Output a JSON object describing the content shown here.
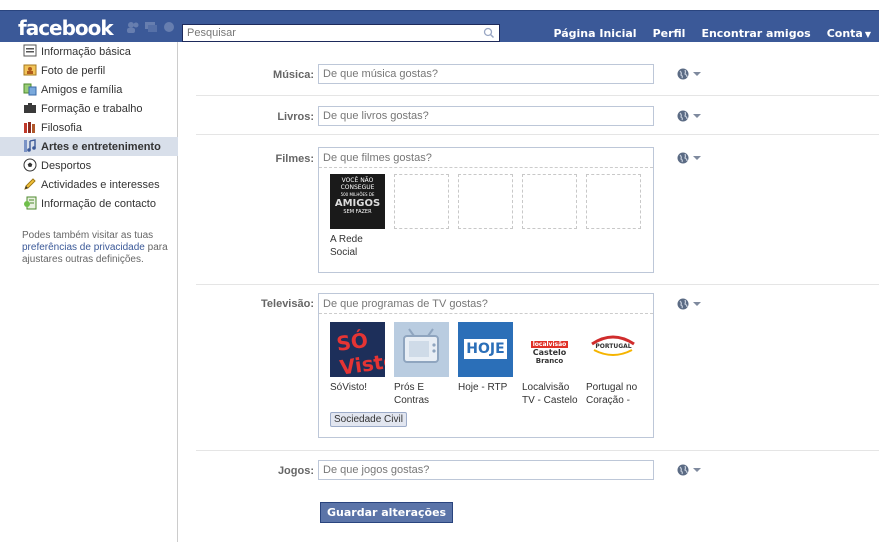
{
  "topbar": {
    "logo": "facebook",
    "search_placeholder": "Pesquisar",
    "nav": [
      {
        "label": "Página Inicial"
      },
      {
        "label": "Perfil"
      },
      {
        "label": "Encontrar amigos"
      },
      {
        "label": "Conta"
      }
    ]
  },
  "sidebar": {
    "items": [
      {
        "label": "Informação básica",
        "icon": "info-icon"
      },
      {
        "label": "Foto de perfil",
        "icon": "photo-icon"
      },
      {
        "label": "Amigos e família",
        "icon": "friends-icon"
      },
      {
        "label": "Formação e trabalho",
        "icon": "briefcase-icon"
      },
      {
        "label": "Filosofia",
        "icon": "books-icon"
      },
      {
        "label": "Artes e entretenimento",
        "icon": "music-icon",
        "active": true
      },
      {
        "label": "Desportos",
        "icon": "soccer-ball-icon"
      },
      {
        "label": "Actividades e interesses",
        "icon": "pencil-icon"
      },
      {
        "label": "Informação de contacto",
        "icon": "contact-icon"
      }
    ],
    "note_prefix": "Podes também visitar as tuas",
    "note_link": "preferências de privacidade",
    "note_suffix": "para ajustares outras definições."
  },
  "form": {
    "musica": {
      "label": "Música:",
      "placeholder": "De que música gostas?"
    },
    "livros": {
      "label": "Livros:",
      "placeholder": "De que livros gostas?"
    },
    "filmes": {
      "label": "Filmes:",
      "placeholder": "De que filmes gostas?",
      "items": [
        {
          "title_line1": "A Rede",
          "title_line2": "Social",
          "thumb_text": [
            "VOCÊ NÃO",
            "CONSEGUE",
            "500 MILHÕES DE",
            "AMIGOS",
            "SEM FAZER"
          ]
        }
      ]
    },
    "televisao": {
      "label": "Televisão:",
      "placeholder": "De que programas de TV gostas?",
      "items": [
        {
          "line1": "SóVisto!",
          "line2": "",
          "thumb": "SÓ Visto"
        },
        {
          "line1": "Prós E",
          "line2": "Contras",
          "thumb": ""
        },
        {
          "line1": "Hoje - RTP",
          "line2": "",
          "thumb": "HOJE"
        },
        {
          "line1": "Localvisão",
          "line2": "TV - Castelo",
          "thumb_l1": "localvisão",
          "thumb_l2": "Castelo",
          "thumb_l3": "Branco"
        },
        {
          "line1": "Portugal no",
          "line2": "Coração -",
          "thumb": "PORTUGAL"
        }
      ],
      "tags": [
        "Sociedade Civil"
      ]
    },
    "jogos": {
      "label": "Jogos:",
      "placeholder": "De que jogos gostas?"
    },
    "save_label": "Guardar alterações"
  },
  "colors": {
    "brand": "#3b5998",
    "sidebar_active": "#d8dfea",
    "input_border": "#bdc7d8"
  }
}
